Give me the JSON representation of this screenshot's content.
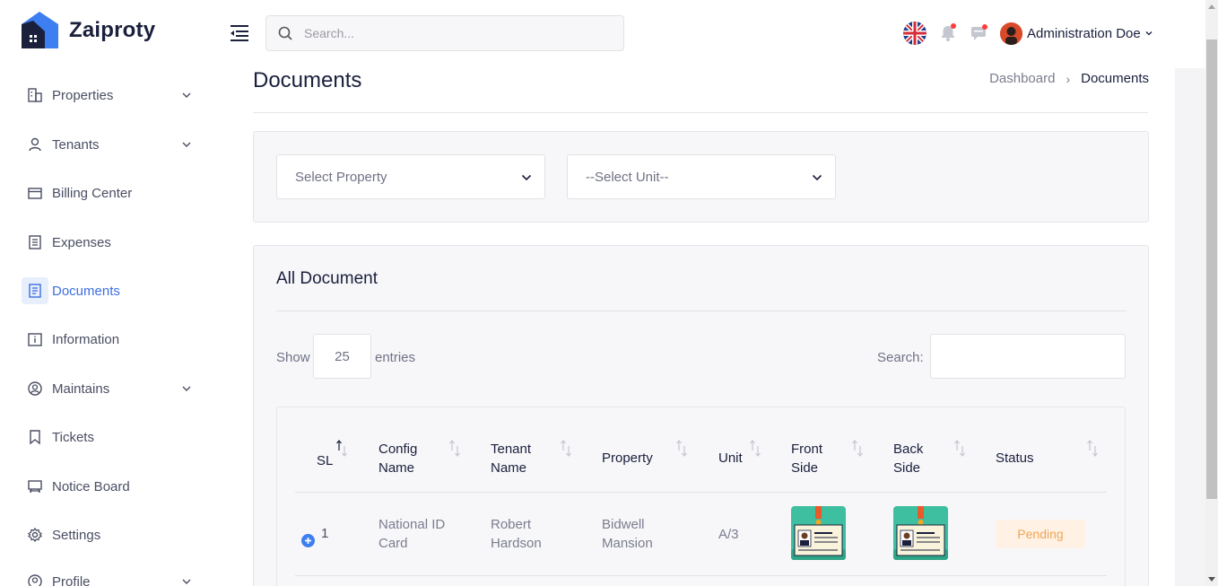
{
  "app": {
    "name": "Zaiproty"
  },
  "header": {
    "search_placeholder": "Search...",
    "user_name": "Administration Doe",
    "language_icon": "uk-flag-icon",
    "notification_icon": "bell-icon",
    "message_icon": "chat-icon"
  },
  "sidebar": {
    "items": [
      {
        "label": "Properties",
        "icon": "building-icon",
        "expandable": true
      },
      {
        "label": "Tenants",
        "icon": "user-icon",
        "expandable": true
      },
      {
        "label": "Billing Center",
        "icon": "folder-icon",
        "expandable": false
      },
      {
        "label": "Expenses",
        "icon": "receipt-icon",
        "expandable": false
      },
      {
        "label": "Documents",
        "icon": "document-icon",
        "expandable": false,
        "active": true
      },
      {
        "label": "Information",
        "icon": "info-icon",
        "expandable": false
      },
      {
        "label": "Maintains",
        "icon": "user-circle-icon",
        "expandable": true
      },
      {
        "label": "Tickets",
        "icon": "bookmark-icon",
        "expandable": false
      },
      {
        "label": "Notice Board",
        "icon": "board-icon",
        "expandable": false
      },
      {
        "label": "Settings",
        "icon": "gear-icon",
        "expandable": false
      },
      {
        "label": "Profile",
        "icon": "profile-icon",
        "expandable": true
      }
    ]
  },
  "page": {
    "title": "Documents",
    "breadcrumb": {
      "home": "Dashboard",
      "current": "Documents"
    }
  },
  "filters": {
    "property_select": "Select Property",
    "unit_select": "--Select Unit--"
  },
  "documents_table": {
    "title": "All Document",
    "show_label": "Show",
    "entries_value": "25",
    "entries_label": "entries",
    "search_label": "Search:",
    "columns": {
      "sl": "SL",
      "config_name": [
        "Config",
        "Name"
      ],
      "tenant_name": [
        "Tenant",
        "Name"
      ],
      "property": "Property",
      "unit": "Unit",
      "front_side": [
        "Front",
        "Side"
      ],
      "back_side": [
        "Back",
        "Side"
      ],
      "status": "Status"
    },
    "rows": [
      {
        "sl": "1",
        "config_name": [
          "National ID",
          "Card"
        ],
        "tenant_name": [
          "Robert",
          "Hardson"
        ],
        "property": [
          "Bidwell",
          "Mansion"
        ],
        "unit": "A/3",
        "front_side_icon": "id-card-icon",
        "back_side_icon": "id-card-icon",
        "status": "Pending"
      }
    ]
  },
  "colors": {
    "accent": "#3d6fe0",
    "pending_bg": "#fff1e3",
    "pending_text": "#f0a657",
    "logo": "#3d7ef0"
  }
}
